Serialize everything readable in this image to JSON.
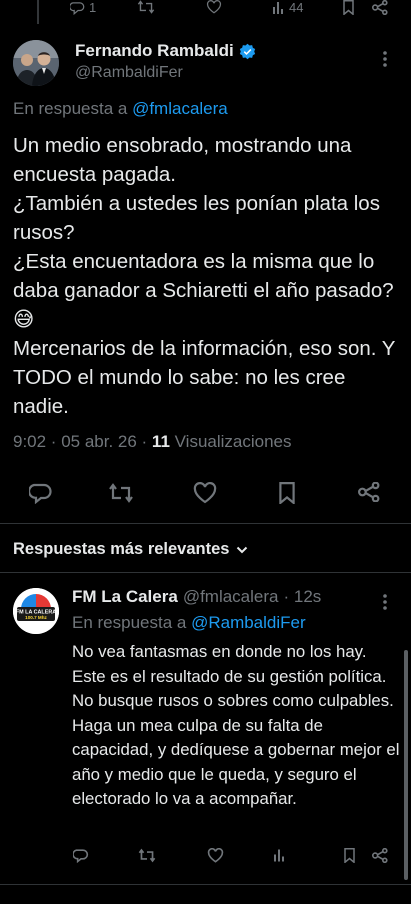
{
  "prev_tweet_actions": {
    "reply_count": "1",
    "views_count": "44"
  },
  "main_tweet": {
    "author_name": "Fernando Rambaldi",
    "author_handle": "@RambaldiFer",
    "reply_prefix": "En respuesta a ",
    "reply_mention": "@fmlacalera",
    "text": "Un medio ensobrado, mostrando una encuesta pagada.\n¿También a ustedes les ponían plata los rusos?\n¿Esta encuentadora es la misma que lo daba ganador a Schiaretti el año pasado? 😅\nMercenarios de la información, eso son. Y TODO el mundo lo sabe: no les cree nadie.",
    "timestamp": "9:02 · 05 abr. 26 · ",
    "views_number": "11",
    "views_label": " Visualizaciones",
    "verified_color": "#1d9bf0"
  },
  "sort_bar": {
    "label": "Respuestas más relevantes"
  },
  "reply": {
    "author_name": "FM La Calera",
    "author_handle": "@fmlacalera",
    "time": "· 12s",
    "reply_prefix": "En respuesta a ",
    "reply_mention": "@RambaldiFer",
    "text": "No vea fantasmas en donde no los hay. Este es el resultado de su gestión política. No busque rusos o sobres como culpables. Haga un mea culpa de su falta de capacidad, y dedíquese a gobernar mejor el año y medio que le queda, y seguro el electorado lo va a acompañar.",
    "avatar_text_top": "FM LA CALERA",
    "avatar_text_bottom": "100.7 Mhz"
  },
  "colors": {
    "background": "#000000",
    "text": "#e7e9ea",
    "muted": "#71767b",
    "accent": "#1d9bf0"
  }
}
